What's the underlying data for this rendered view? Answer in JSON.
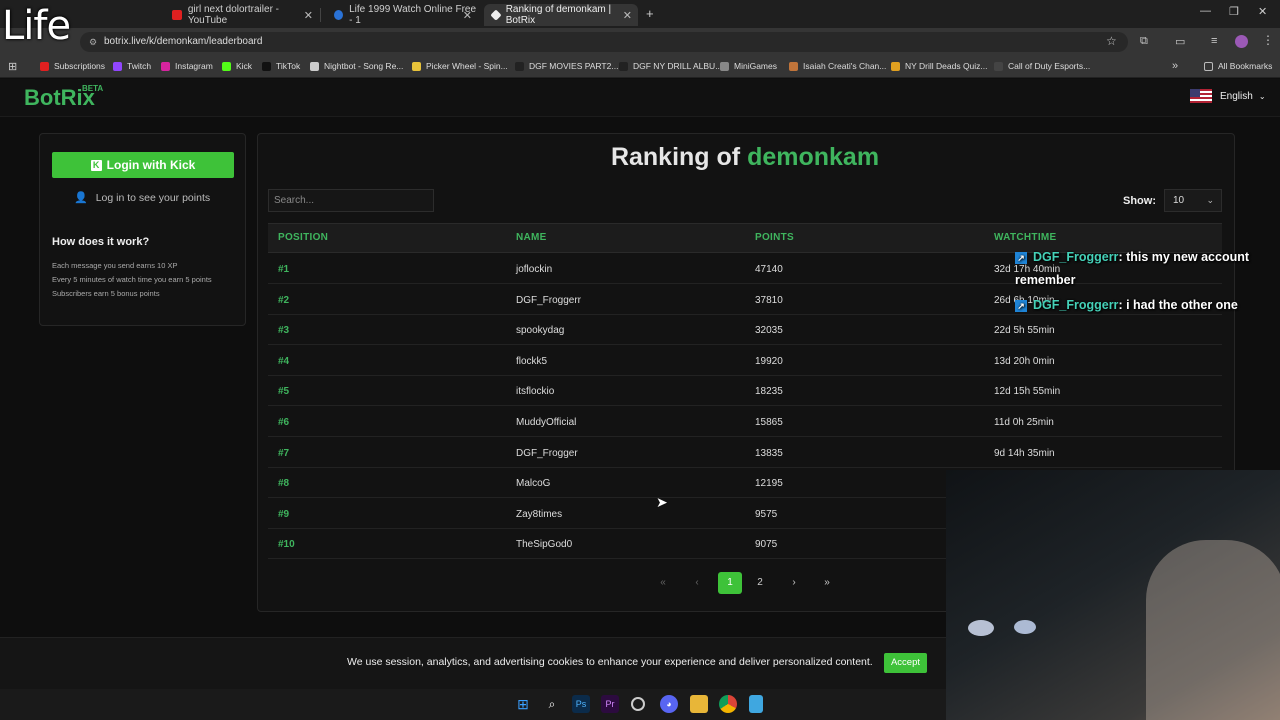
{
  "overlay_logo": "Life",
  "browser": {
    "tabs": [
      {
        "title": "girl next dolortrailer - YouTube",
        "color": "#e02020"
      },
      {
        "title": "Life 1999 Watch Online Free - 1",
        "color": "#2a72d6"
      },
      {
        "title": "Ranking of demonkam | BotRix",
        "color": "#eeeeee"
      }
    ],
    "new_tab_label": "+",
    "url": "botrix.live/k/demonkam/leaderboard",
    "bookmarks": [
      {
        "label": "Subscriptions",
        "color": "#e02020"
      },
      {
        "label": "Twitch",
        "color": "#9146ff"
      },
      {
        "label": "Instagram",
        "color": "#d6249f"
      },
      {
        "label": "Kick",
        "color": "#53fc18"
      },
      {
        "label": "TikTok",
        "color": "#111111"
      },
      {
        "label": "Nightbot - Song Re...",
        "color": "#cccccc"
      },
      {
        "label": "Picker Wheel - Spin...",
        "color": "#e8c33a"
      },
      {
        "label": "DGF MOVIES PART2...",
        "color": "#222222"
      },
      {
        "label": "DGF NY DRILL ALBU...",
        "color": "#222222"
      },
      {
        "label": "MiniGames",
        "color": "#888888"
      },
      {
        "label": "Isaiah Creati's Chan...",
        "color": "#c0743a"
      },
      {
        "label": "NY Drill Deads Quiz...",
        "color": "#e0a020"
      },
      {
        "label": "Call of Duty Esports...",
        "color": "#444444"
      }
    ],
    "more_bookmarks": "»",
    "all_bookmarks": "All Bookmarks"
  },
  "site": {
    "logo": "BotRix",
    "beta": "BETA",
    "language": "English",
    "accent": "#3fb55e"
  },
  "sidebar": {
    "login_kick": "Login with Kick",
    "login_points": "Log in to see your points",
    "how_title": "How does it work?",
    "rules": [
      "Each message you send earns 10 XP",
      "Every 5 minutes of watch time you earn 5 points",
      "Subscribers earn 5 bonus points"
    ]
  },
  "leaderboard": {
    "title_prefix": "Ranking of",
    "channel": "demonkam",
    "search_placeholder": "Search...",
    "show_label": "Show:",
    "show_value": "10",
    "columns": [
      "POSITION",
      "NAME",
      "POINTS",
      "WATCHTIME"
    ],
    "rows": [
      {
        "pos": "#1",
        "name": "joflockin",
        "points": "47140",
        "watchtime": "32d 17h 40min"
      },
      {
        "pos": "#2",
        "name": "DGF_Froggerr",
        "points": "37810",
        "watchtime": "26d 6h 10min"
      },
      {
        "pos": "#3",
        "name": "spookydag",
        "points": "32035",
        "watchtime": "22d 5h 55min"
      },
      {
        "pos": "#4",
        "name": "flockk5",
        "points": "19920",
        "watchtime": "13d 20h 0min"
      },
      {
        "pos": "#5",
        "name": "itsflockio",
        "points": "18235",
        "watchtime": "12d 15h 55min"
      },
      {
        "pos": "#6",
        "name": "MuddyOfficial",
        "points": "15865",
        "watchtime": "11d 0h 25min"
      },
      {
        "pos": "#7",
        "name": "DGF_Frogger",
        "points": "13835",
        "watchtime": "9d 14h 35min"
      },
      {
        "pos": "#8",
        "name": "MalcoG",
        "points": "12195",
        "watchtime": ""
      },
      {
        "pos": "#9",
        "name": "Zay8times",
        "points": "9575",
        "watchtime": ""
      },
      {
        "pos": "#10",
        "name": "TheSipGod0",
        "points": "9075",
        "watchtime": ""
      }
    ],
    "pager": {
      "first": "«",
      "prev": "‹",
      "pages": [
        "1",
        "2"
      ],
      "current": "1",
      "next": "›",
      "last": "»"
    }
  },
  "chat_overlay": [
    {
      "user": "DGF_Froggerr",
      "message": ": this my new account",
      "continuation": "remember"
    },
    {
      "user": "DGF_Froggerr",
      "message": ": i had the other one",
      "continuation": ""
    }
  ],
  "cookie": {
    "text": "We use session, analytics, and advertising cookies to enhance your experience and deliver personalized content.",
    "accept": "Accept"
  }
}
